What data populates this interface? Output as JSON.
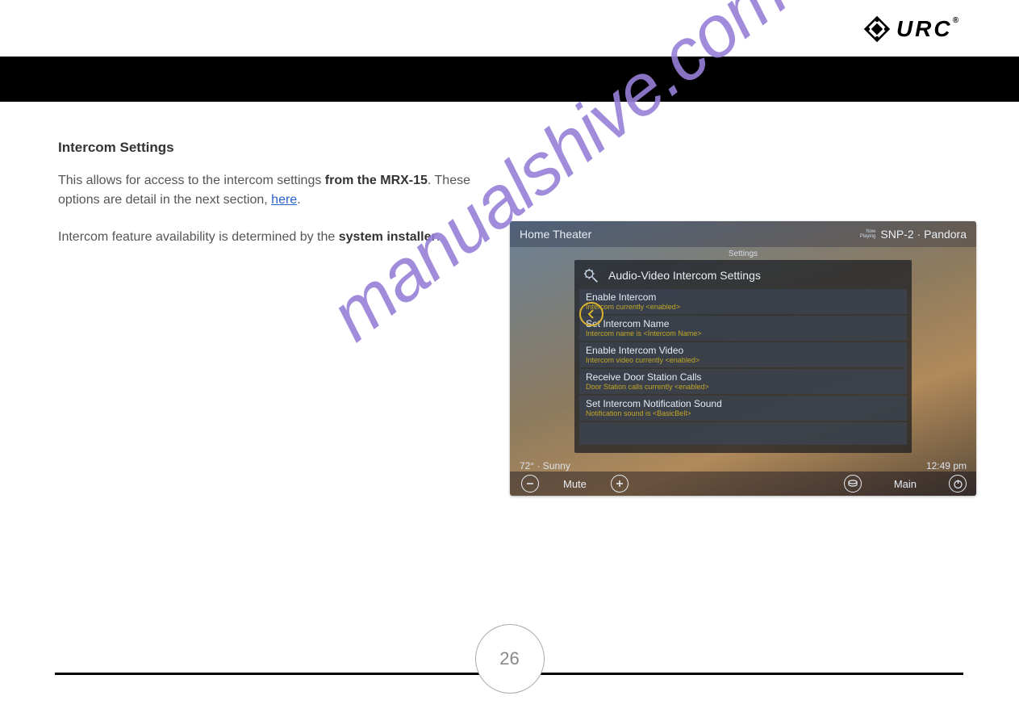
{
  "logo": {
    "text": "URC",
    "reg": "®"
  },
  "section": {
    "title": "Intercom Settings",
    "p1a": "This allows for access to the intercom settings ",
    "p1b": "from the MRX-15",
    "p1c": ". These options are detail in the next section, ",
    "p1_link": "here",
    "p1d": ".",
    "p2a": "Intercom feature availability is determined by the ",
    "p2b": "system installer",
    "p2c": "."
  },
  "watermark": "manualshive.com",
  "shot": {
    "room": "Home Theater",
    "now_playing_label": "Now\nPlaying",
    "now_playing_value": "SNP-2 · Pandora",
    "settings_label": "Settings",
    "panel_title": "Audio-Video Intercom Settings",
    "rows": [
      {
        "t": "Enable Intercom",
        "s": "Intercom currently <enabled>"
      },
      {
        "t": "Set Intercom Name",
        "s": "Intercom name is <Intercom Name>"
      },
      {
        "t": "Enable Intercom Video",
        "s": "Intercom video currently <enabled>"
      },
      {
        "t": "Receive Door Station Calls",
        "s": "Door Station calls currently <enabled>"
      },
      {
        "t": "Set Intercom Notification Sound",
        "s": "Notification sound is <BasicBell>"
      }
    ],
    "weather": "72° · Sunny",
    "time": "12:49 pm",
    "mute_label": "Mute",
    "main_label": "Main"
  },
  "page_number": "26"
}
